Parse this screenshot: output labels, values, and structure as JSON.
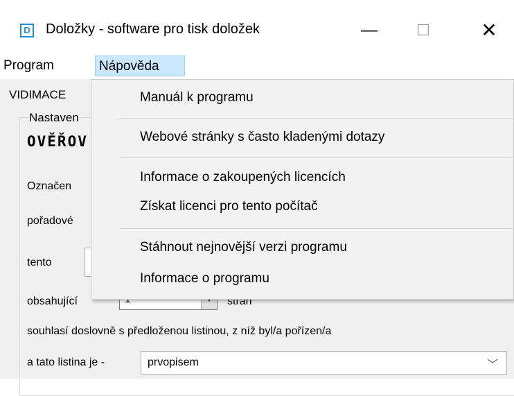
{
  "window": {
    "icon_letter": "D",
    "title": "Doložky - software pro tisk doložek",
    "minimize_glyph": "—",
    "maximize_glyph": "☐",
    "close_glyph": "✕"
  },
  "menubar": {
    "items": [
      {
        "label": "Program"
      },
      {
        "label": "Nápověda"
      }
    ]
  },
  "form": {
    "tab_label": "VIDIMACE",
    "group_label": "Nastaven",
    "heading": "OVĚŘOV",
    "label_oznaceni": "Označen",
    "label_poradove": "pořadové",
    "label_tento": "tento",
    "label_obsahujici": "obsahující",
    "pages_value": "1",
    "label_stran": "stran",
    "agreement_text": "souhlasí doslovně s předloženou listinou, z níž byl/a pořízen/a",
    "label_listina": "a tato listina je -",
    "listina_value": "prvopisem",
    "down_arrow_glyph": "▼",
    "chevron_glyph": "﹀"
  },
  "help_menu": {
    "items": [
      {
        "label": "Manuál k programu"
      },
      {
        "label": "Webové stránky s často kladenými dotazy"
      },
      {
        "label": "Informace o zakoupených licencích"
      },
      {
        "label": "Získat licenci pro tento počítač"
      },
      {
        "label": "Stáhnout nejnovější verzi programu"
      },
      {
        "label": "Informace o programu"
      }
    ]
  }
}
